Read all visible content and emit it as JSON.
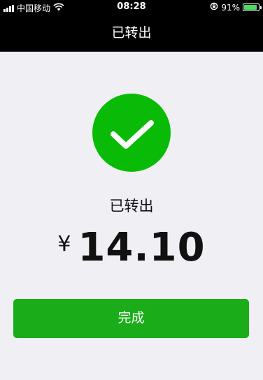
{
  "status_bar": {
    "carrier": "中国移动",
    "time": "08:28",
    "battery_percent": "91%",
    "battery_level": 0.91,
    "icons": [
      "signal-icon",
      "wifi-icon",
      "orientation-lock-icon",
      "battery-icon"
    ]
  },
  "nav": {
    "title": "已转出"
  },
  "result": {
    "icon": "check-icon",
    "icon_color": "#09bb07",
    "status": "已转出",
    "currency_symbol": "¥",
    "amount": "14.10"
  },
  "actions": {
    "done_label": "完成",
    "done_color": "#1aad19"
  }
}
